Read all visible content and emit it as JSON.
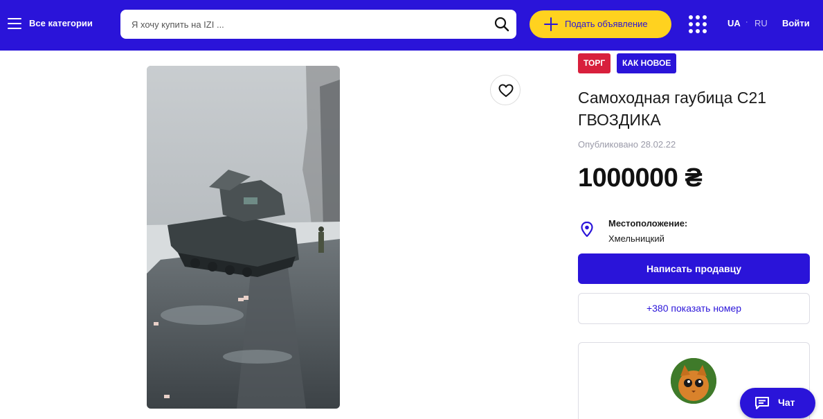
{
  "header": {
    "menu_icon": "hamburger-icon",
    "categories_label": "Все категории",
    "search_placeholder": "Я хочу купить на IZI ...",
    "search_icon": "search-icon",
    "post_ad_label": "Подать объявление",
    "post_ad_icon": "plus-icon",
    "apps_icon": "grid-icon",
    "lang_active": "UA",
    "lang_separator": "·",
    "lang_other": "RU",
    "login_label": "Войти",
    "colors": {
      "brand": "#2a14d9",
      "accent": "#ffd21f"
    }
  },
  "listing": {
    "tags": [
      {
        "label": "ТОРГ",
        "color": "#d81f3c"
      },
      {
        "label": "КАК НОВОЕ",
        "color": "#2a14d9"
      }
    ],
    "title": "Самоходная гаубица С21 ГВОЗДИКА",
    "published": "Опубликовано 28.02.22",
    "price": "1000000 ₴",
    "location_label": "Местоположение:",
    "location_value": "Хмельницкий",
    "location_icon": "map-pin-icon",
    "favorite_icon": "heart-icon",
    "write_seller_label": "Написать продавцу",
    "show_phone_label": "+380 показать номер"
  },
  "chat": {
    "label": "Чат",
    "icon": "chat-icon"
  }
}
